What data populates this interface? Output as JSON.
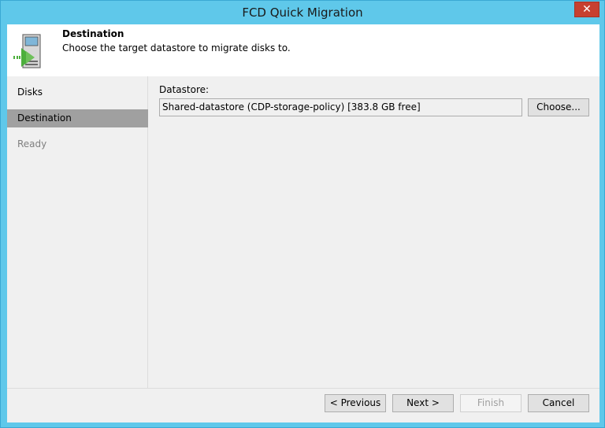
{
  "window": {
    "title": "FCD Quick Migration",
    "close_glyph": "✕"
  },
  "header": {
    "title": "Destination",
    "subtitle": "Choose the target datastore to migrate disks to.",
    "icon": "migration-wizard-icon"
  },
  "nav": {
    "items": [
      {
        "label": "Disks",
        "state": "normal"
      },
      {
        "label": "Destination",
        "state": "active"
      },
      {
        "label": "Ready",
        "state": "disabled"
      }
    ]
  },
  "content": {
    "datastore_label": "Datastore:",
    "datastore_value": "Shared-datastore (CDP-storage-policy) [383.8 GB free]",
    "choose_label": "Choose..."
  },
  "footer": {
    "previous_label": "< Previous",
    "next_label": "Next >",
    "finish_label": "Finish",
    "cancel_label": "Cancel"
  },
  "colors": {
    "frame": "#5fc8ea",
    "active_nav": "#a0a0a0",
    "close": "#c7402f",
    "icon_green": "#4caf3c"
  }
}
